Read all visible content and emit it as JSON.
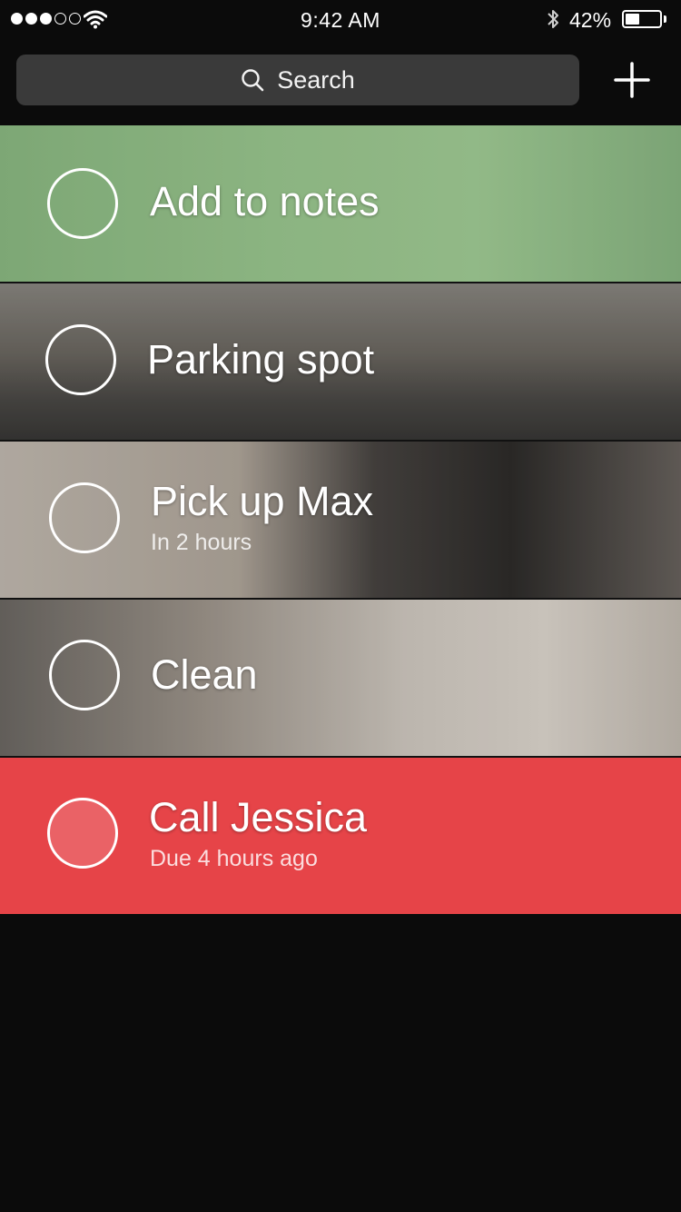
{
  "status_bar": {
    "time": "9:42 AM",
    "battery_percent": "42%",
    "battery_level": 0.42,
    "signal_bars_total": 5,
    "signal_bars_filled": 3,
    "icons": [
      "signal-dots-icon",
      "wifi-icon",
      "bluetooth-icon",
      "battery-icon"
    ]
  },
  "header": {
    "search_label": "Search",
    "search_icon": "search-icon",
    "add_icon": "plus-icon"
  },
  "tasks": [
    {
      "title": "Add to notes",
      "subtitle": "",
      "background": "diagram photo"
    },
    {
      "title": "Parking spot",
      "subtitle": "",
      "background": "street photo"
    },
    {
      "title": "Pick up Max",
      "subtitle": "In 2 hours",
      "background": "dog photo"
    },
    {
      "title": "Clean",
      "subtitle": "",
      "background": "bed photo"
    },
    {
      "title": "Call Jessica",
      "subtitle": "Due 4 hours ago",
      "background": "red"
    }
  ],
  "colors": {
    "background": "#0b0b0b",
    "search_field": "#3a3a3a",
    "overdue": "#e64448"
  }
}
